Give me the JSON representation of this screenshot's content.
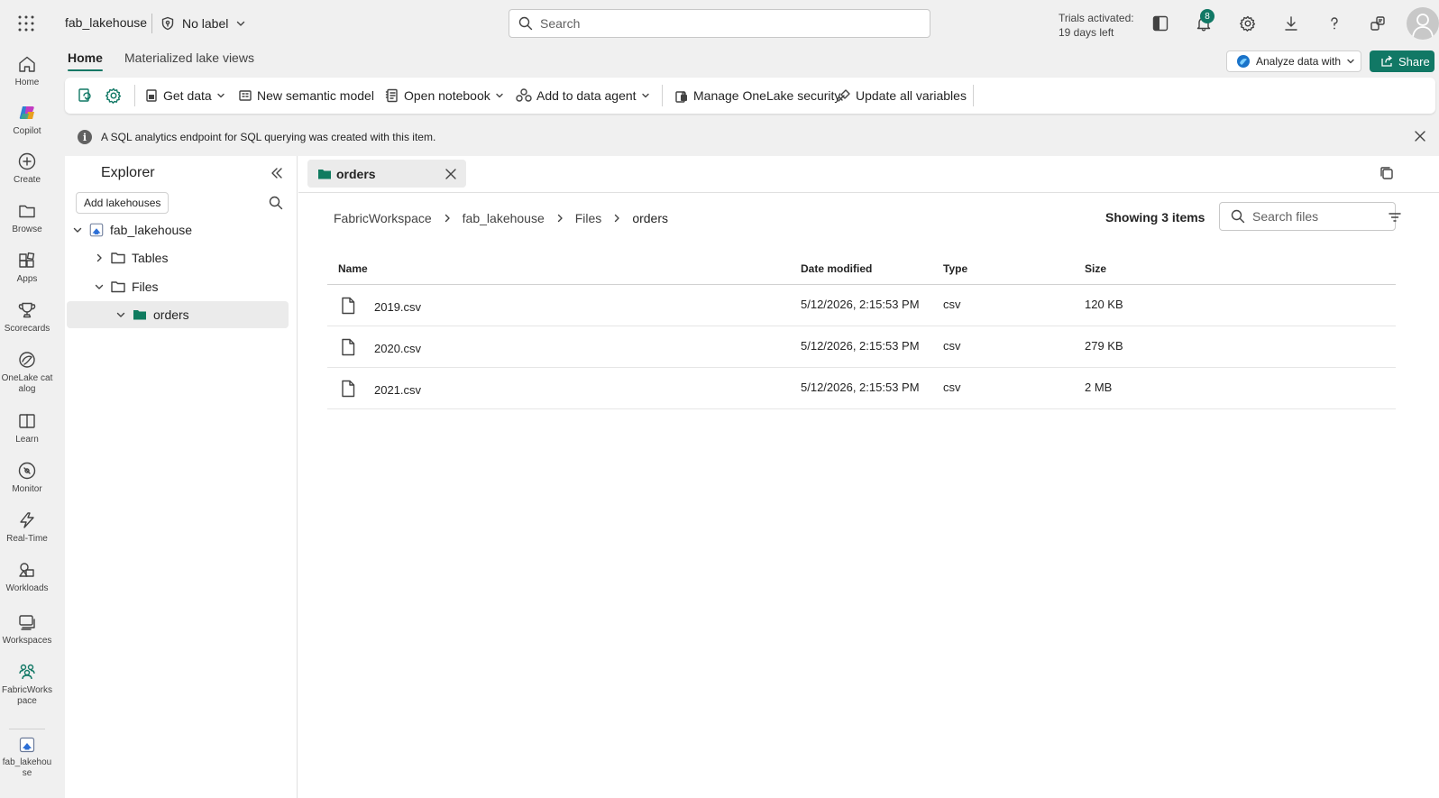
{
  "topbar": {
    "item_name": "fab_lakehouse",
    "sensitivity_label": "No label",
    "search_placeholder": "Search",
    "trial_line1": "Trials activated:",
    "trial_line2": "19 days left",
    "notification_count": "8"
  },
  "rail": [
    {
      "label": "Home",
      "icon": "home-icon"
    },
    {
      "label": "Copilot",
      "icon": "copilot-icon"
    },
    {
      "label": "Create",
      "icon": "plus-circle-icon"
    },
    {
      "label": "Browse",
      "icon": "folder-icon"
    },
    {
      "label": "Apps",
      "icon": "apps-icon"
    },
    {
      "label": "Scorecards",
      "icon": "trophy-icon"
    },
    {
      "label": "OneLake catalog",
      "icon": "onelake-icon"
    },
    {
      "label": "Learn",
      "icon": "book-icon"
    },
    {
      "label": "Monitor",
      "icon": "monitor-icon"
    },
    {
      "label": "Real-Time",
      "icon": "lightning-icon"
    },
    {
      "label": "Workloads",
      "icon": "workloads-icon"
    },
    {
      "label": "Workspaces",
      "icon": "workspaces-icon"
    },
    {
      "label": "FabricWorkspace",
      "icon": "workspace-people-icon"
    },
    {
      "label": "fab_lakehouse",
      "icon": "lakehouse-icon"
    }
  ],
  "ribbon_tabs": {
    "home": "Home",
    "materialized": "Materialized lake views"
  },
  "actions": {
    "analyze": "Analyze data with",
    "share": "Share"
  },
  "ribbon": {
    "get_data": "Get data",
    "new_semantic_model": "New semantic model",
    "open_notebook": "Open notebook",
    "add_to_data_agent": "Add to data agent",
    "manage_security": "Manage OneLake security",
    "update_variables": "Update all variables"
  },
  "info_bar": {
    "text": "A SQL analytics endpoint for SQL querying was created with this item."
  },
  "explorer": {
    "title": "Explorer",
    "add_lakehouses": "Add lakehouses",
    "tree": [
      {
        "label": "fab_lakehouse",
        "expanded": true
      },
      {
        "label": "Tables",
        "expanded": false
      },
      {
        "label": "Files",
        "expanded": true
      },
      {
        "label": "orders",
        "expanded": true,
        "selected": true
      }
    ]
  },
  "content": {
    "tab_label": "orders",
    "breadcrumb": [
      "FabricWorkspace",
      "fab_lakehouse",
      "Files",
      "orders"
    ],
    "showing": "Showing 3 items",
    "search_placeholder": "Search files",
    "columns": {
      "name": "Name",
      "date": "Date modified",
      "type": "Type",
      "size": "Size"
    },
    "files": [
      {
        "name": "2019.csv",
        "date": "5/12/2026, 2:15:53 PM",
        "type": "csv",
        "size": "120 KB"
      },
      {
        "name": "2020.csv",
        "date": "5/12/2026, 2:15:53 PM",
        "type": "csv",
        "size": "279 KB"
      },
      {
        "name": "2021.csv",
        "date": "5/12/2026, 2:15:53 PM",
        "type": "csv",
        "size": "2 MB"
      }
    ]
  },
  "colors": {
    "accent": "#117865",
    "folder_green": "#0f7b5f"
  }
}
